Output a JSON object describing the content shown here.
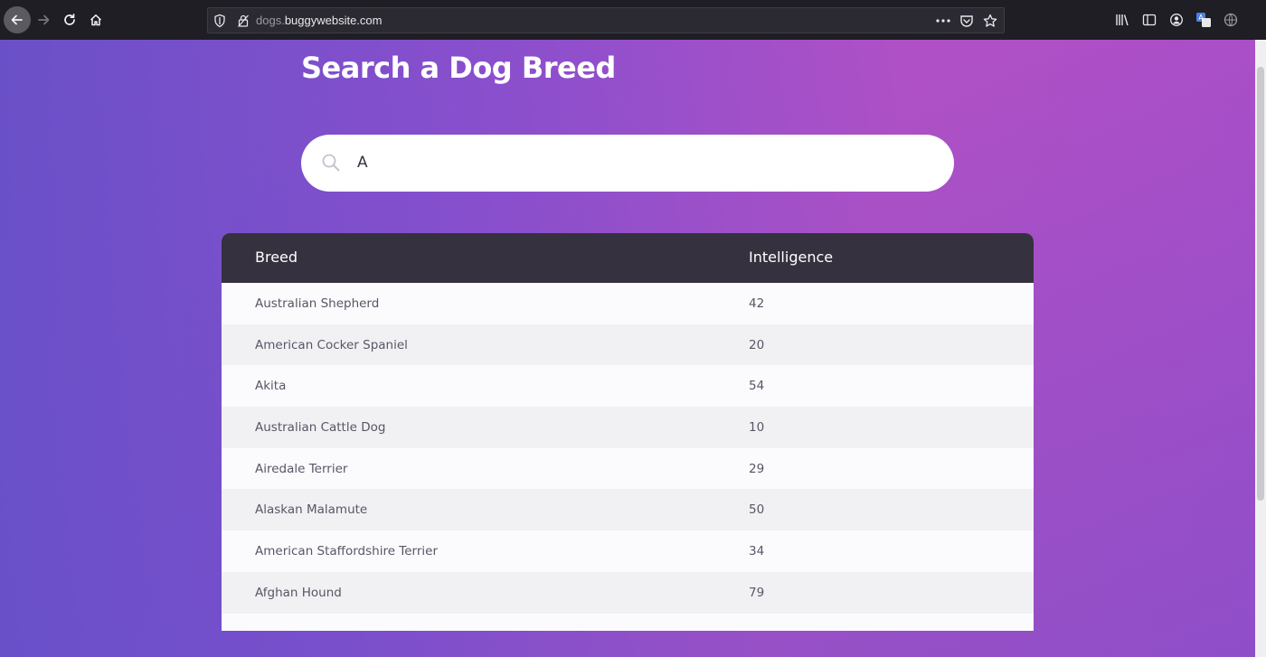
{
  "browser": {
    "url_sub": "dogs.",
    "url_domain": "buggywebsite.com"
  },
  "page": {
    "title": "Search a Dog Breed",
    "search": {
      "value": "A"
    }
  },
  "table": {
    "headers": {
      "breed": "Breed",
      "intelligence": "Intelligence"
    },
    "rows": [
      {
        "breed": "Australian Shepherd",
        "intelligence": "42"
      },
      {
        "breed": "American Cocker Spaniel",
        "intelligence": "20"
      },
      {
        "breed": "Akita",
        "intelligence": "54"
      },
      {
        "breed": "Australian Cattle Dog",
        "intelligence": "10"
      },
      {
        "breed": "Airedale Terrier",
        "intelligence": "29"
      },
      {
        "breed": "Alaskan Malamute",
        "intelligence": "50"
      },
      {
        "breed": "American Staffordshire Terrier",
        "intelligence": "34"
      },
      {
        "breed": "Afghan Hound",
        "intelligence": "79"
      }
    ]
  },
  "colors": {
    "gradient_left": "#6a50c8",
    "gradient_right": "#b150c6",
    "header_bg": "#36313e"
  }
}
